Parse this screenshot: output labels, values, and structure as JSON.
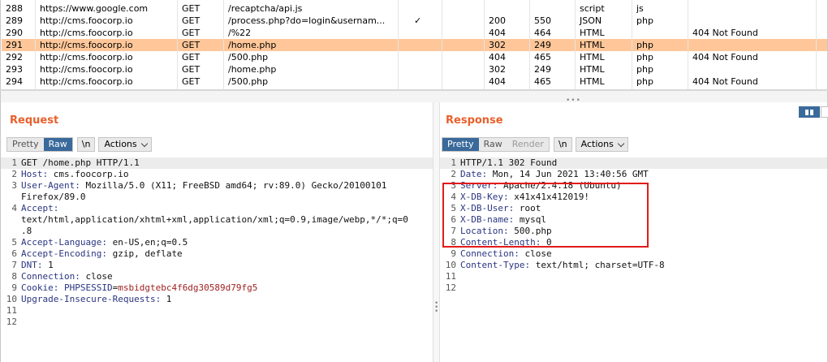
{
  "history": {
    "rows": [
      {
        "num": "288",
        "host": "https://www.google.com",
        "method": "GET",
        "url": "/recaptcha/api.js",
        "edited": "",
        "status": "",
        "length": "",
        "mime": "script",
        "ext": "js",
        "title": "",
        "selected": false
      },
      {
        "num": "289",
        "host": "http://cms.foocorp.io",
        "method": "GET",
        "url": "/process.php?do=login&usernam...",
        "edited": "✓",
        "status": "200",
        "length": "550",
        "mime": "JSON",
        "ext": "php",
        "title": "",
        "selected": false
      },
      {
        "num": "290",
        "host": "http://cms.foocorp.io",
        "method": "GET",
        "url": "/%22",
        "edited": "",
        "status": "404",
        "length": "464",
        "mime": "HTML",
        "ext": "",
        "title": "404 Not Found",
        "selected": false
      },
      {
        "num": "291",
        "host": "http://cms.foocorp.io",
        "method": "GET",
        "url": "/home.php",
        "edited": "",
        "status": "302",
        "length": "249",
        "mime": "HTML",
        "ext": "php",
        "title": "",
        "selected": true
      },
      {
        "num": "292",
        "host": "http://cms.foocorp.io",
        "method": "GET",
        "url": "/500.php",
        "edited": "",
        "status": "404",
        "length": "465",
        "mime": "HTML",
        "ext": "php",
        "title": "404 Not Found",
        "selected": false
      },
      {
        "num": "293",
        "host": "http://cms.foocorp.io",
        "method": "GET",
        "url": "/home.php",
        "edited": "",
        "status": "302",
        "length": "249",
        "mime": "HTML",
        "ext": "php",
        "title": "",
        "selected": false
      },
      {
        "num": "294",
        "host": "http://cms.foocorp.io",
        "method": "GET",
        "url": "/500.php",
        "edited": "",
        "status": "404",
        "length": "465",
        "mime": "HTML",
        "ext": "php",
        "title": "404 Not Found",
        "selected": false
      }
    ]
  },
  "request": {
    "title": "Request",
    "tabs": {
      "pretty": "Pretty",
      "raw": "Raw"
    },
    "newline_label": "\\n",
    "actions_label": "Actions",
    "lines": [
      {
        "n": "1",
        "name": "",
        "value": "GET /home.php HTTP/1.1"
      },
      {
        "n": "2",
        "name": "Host:",
        "value": " cms.foocorp.io"
      },
      {
        "n": "3",
        "name": "User-Agent:",
        "value": " Mozilla/5.0 (X11; FreeBSD amd64; rv:89.0) Gecko/20100101"
      },
      {
        "n": "",
        "name": "",
        "value": "Firefox/89.0"
      },
      {
        "n": "4",
        "name": "Accept:",
        "value": ""
      },
      {
        "n": "",
        "name": "",
        "value": "text/html,application/xhtml+xml,application/xml;q=0.9,image/webp,*/*;q=0"
      },
      {
        "n": "",
        "name": "",
        "value": ".8"
      },
      {
        "n": "5",
        "name": "Accept-Language:",
        "value": " en-US,en;q=0.5"
      },
      {
        "n": "6",
        "name": "Accept-Encoding:",
        "value": " gzip, deflate"
      },
      {
        "n": "7",
        "name": "DNT:",
        "value": " 1"
      },
      {
        "n": "8",
        "name": "Connection:",
        "value": " close"
      },
      {
        "n": "9",
        "name": "Cookie:",
        "value": " PHPSESSID",
        "cookie_eq": "=",
        "cookie_val": "msbidgtebc4f6dg30589d79fg5"
      },
      {
        "n": "10",
        "name": "Upgrade-Insecure-Requests:",
        "value": " 1"
      },
      {
        "n": "11",
        "name": "",
        "value": ""
      },
      {
        "n": "12",
        "name": "",
        "value": ""
      }
    ]
  },
  "response": {
    "title": "Response",
    "tabs": {
      "pretty": "Pretty",
      "raw": "Raw",
      "render": "Render"
    },
    "newline_label": "\\n",
    "actions_label": "Actions",
    "lines": [
      {
        "n": "1",
        "name": "",
        "value": "HTTP/1.1 302 Found"
      },
      {
        "n": "2",
        "name": "Date:",
        "value": " Mon, 14 Jun 2021 13:40:56 GMT"
      },
      {
        "n": "3",
        "name": "Server:",
        "value": " Apache/2.4.18 (Ubuntu)"
      },
      {
        "n": "4",
        "name": "X-DB-Key:",
        "value": " x41x41x412019!"
      },
      {
        "n": "5",
        "name": "X-DB-User:",
        "value": " root"
      },
      {
        "n": "6",
        "name": "X-DB-name:",
        "value": " mysql"
      },
      {
        "n": "7",
        "name": "Location:",
        "value": " 500.php"
      },
      {
        "n": "8",
        "name": "Content-Length:",
        "value": " 0"
      },
      {
        "n": "9",
        "name": "Connection:",
        "value": " close"
      },
      {
        "n": "10",
        "name": "Content-Type:",
        "value": " text/html; charset=UTF-8"
      },
      {
        "n": "11",
        "name": "",
        "value": ""
      },
      {
        "n": "12",
        "name": "",
        "value": ""
      }
    ]
  },
  "icons": {
    "layout": "split-layout-icon",
    "actions_chevron": "chevron-down-icon",
    "grip": "drag-handle-icon"
  },
  "colors": {
    "selected_row": "#ffc799",
    "pane_title": "#e8602c",
    "active_tab": "#3a6a9b",
    "header_name": "#2a3580",
    "highlight": "#e21b1b"
  }
}
